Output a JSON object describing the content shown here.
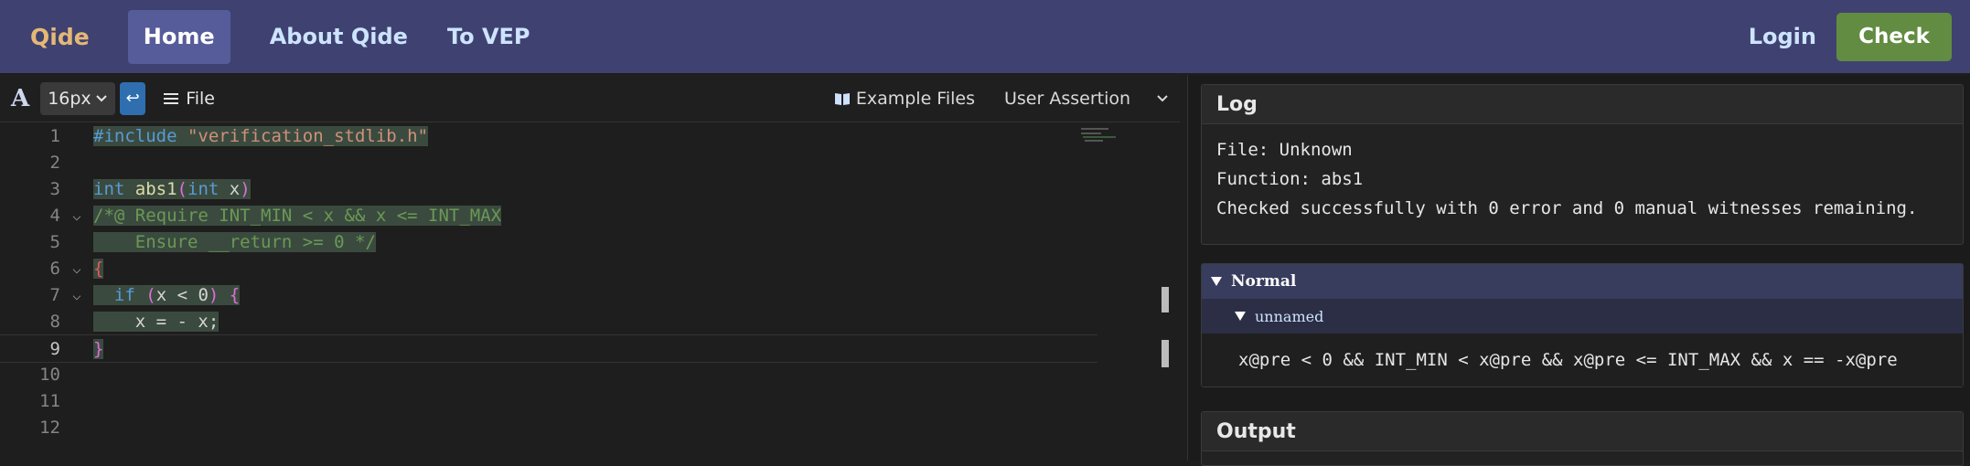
{
  "nav": {
    "brand": "Qide",
    "home": "Home",
    "about": "About Qide",
    "vep": "To VEP",
    "login": "Login",
    "check": "Check"
  },
  "toolbar": {
    "font_icon": "A",
    "font_size": "16px",
    "file": "File",
    "examples": "Example Files",
    "assertion": "User Assertion"
  },
  "code": {
    "line_numbers": [
      "1",
      "2",
      "3",
      "4",
      "5",
      "6",
      "7",
      "8",
      "9",
      "10",
      "11",
      "12"
    ],
    "l1_include": "#include",
    "l1_header": "\"verification_stdlib.h\"",
    "l3_int1": "int",
    "l3_fname": "abs1",
    "l3_int2": "int",
    "l3_param": "x",
    "l4": "/*@ Require INT_MIN < x && x <= INT_MAX",
    "l5": "    Ensure __return >= 0 */",
    "l6": "{",
    "l7_if": "if",
    "l7_cond": "x < 0",
    "l7_brace": "{",
    "l8": "    x = - x;",
    "l9": "}"
  },
  "log": {
    "title": "Log",
    "file": "File: Unknown",
    "function": "Function: abs1",
    "result": "Checked successfully with 0 error and 0 manual witnesses remaining."
  },
  "witness": {
    "normal": "Normal",
    "unnamed": "unnamed",
    "expr": "x@pre < 0 && INT_MIN < x@pre && x@pre <= INT_MAX && x == -x@pre"
  },
  "output": {
    "title": "Output"
  },
  "colors": {
    "navbar": "#3f4270",
    "home_active": "#565c9a",
    "check": "#628c42",
    "brand": "#e5b877"
  }
}
